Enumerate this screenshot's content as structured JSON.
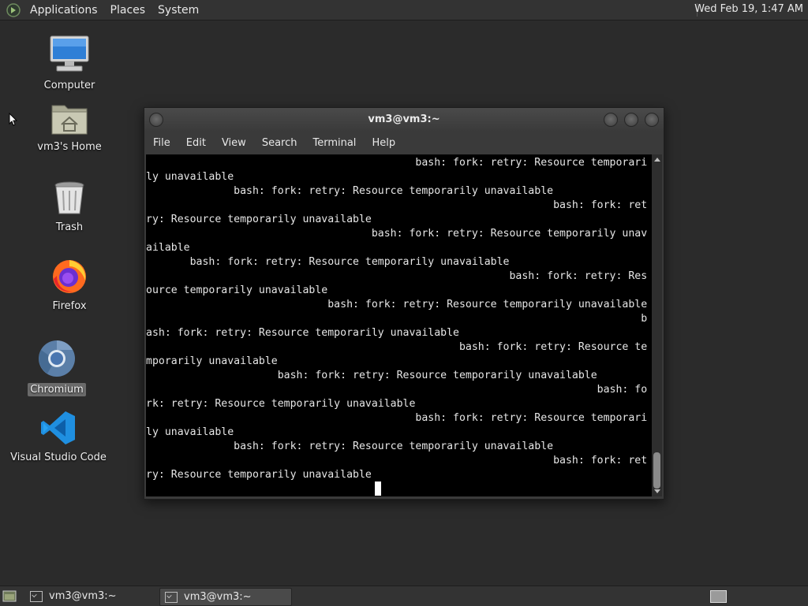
{
  "top_panel": {
    "menus": [
      "Applications",
      "Places",
      "System"
    ],
    "clock": "Wed Feb 19,  1:47 AM"
  },
  "desktop": {
    "icons": [
      {
        "label": "Computer",
        "icon": "computer-icon"
      },
      {
        "label": "vm3's Home",
        "icon": "home-folder-icon"
      },
      {
        "label": "Trash",
        "icon": "trash-icon"
      },
      {
        "label": "Firefox",
        "icon": "firefox-icon"
      },
      {
        "label": "Chromium",
        "icon": "chromium-icon",
        "selected": true
      },
      {
        "label": "Visual Studio Code",
        "icon": "vscode-icon"
      }
    ]
  },
  "terminal": {
    "title": "vm3@vm3:~",
    "menu": [
      "File",
      "Edit",
      "View",
      "Search",
      "Terminal",
      "Help"
    ],
    "lines": [
      "                                           bash: fork: retry: Resource temporari",
      "ly unavailable",
      "              bash: fork: retry: Resource temporarily unavailable",
      "                                                                 bash: fork: ret",
      "ry: Resource temporarily unavailable",
      "                                    bash: fork: retry: Resource temporarily unav",
      "ailable",
      "       bash: fork: retry: Resource temporarily unavailable",
      "                                                          bash: fork: retry: Res",
      "ource temporarily unavailable",
      "                             bash: fork: retry: Resource temporarily unavailable",
      "                                                                               b",
      "ash: fork: retry: Resource temporarily unavailable",
      "                                                  bash: fork: retry: Resource te",
      "mporarily unavailable",
      "                     bash: fork: retry: Resource temporarily unavailable",
      "                                                                        bash: fo",
      "rk: retry: Resource temporarily unavailable",
      "                                           bash: fork: retry: Resource temporari",
      "ly unavailable",
      "              bash: fork: retry: Resource temporarily unavailable",
      "                                                                 bash: fork: ret",
      "ry: Resource temporarily unavailable"
    ]
  },
  "taskbar": {
    "tasks": [
      {
        "label": "vm3@vm3:~",
        "active": false
      },
      {
        "label": "vm3@vm3:~",
        "active": true
      }
    ]
  },
  "colors": {
    "panel": "#333333",
    "desktop": "#2b2b2b",
    "terminal_bg": "#000000",
    "terminal_fg": "#e6e6e6"
  }
}
